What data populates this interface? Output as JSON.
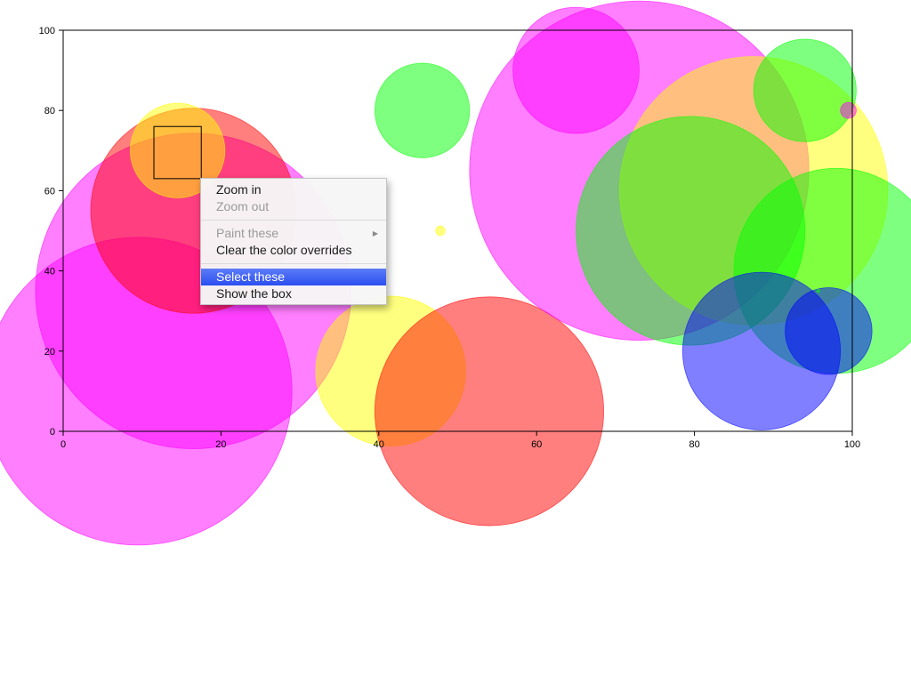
{
  "chart_data": {
    "type": "scatter",
    "variant": "bubble",
    "title": "",
    "xlabel": "",
    "ylabel": "",
    "xlim": [
      0,
      100
    ],
    "ylim": [
      0,
      100
    ],
    "x_ticks": [
      0,
      20,
      40,
      60,
      80,
      100
    ],
    "y_ticks": [
      0,
      20,
      40,
      60,
      80,
      100
    ],
    "grid": false,
    "legend": "none",
    "colors": {
      "magenta": "#ff00ff",
      "red": "#ff0000",
      "yellow": "#ffff00",
      "green": "#00ff00",
      "blue": "#0000ff"
    },
    "bubbles": [
      {
        "x": 9.5,
        "y": 10,
        "r": 19.5,
        "color": "magenta"
      },
      {
        "x": 16.5,
        "y": 35,
        "r": 20,
        "color": "magenta"
      },
      {
        "x": 16.5,
        "y": 55,
        "r": 13,
        "color": "red"
      },
      {
        "x": 14.5,
        "y": 70,
        "r": 6,
        "color": "yellow"
      },
      {
        "x": 41.5,
        "y": 15,
        "r": 9.5,
        "color": "yellow"
      },
      {
        "x": 54,
        "y": 5,
        "r": 14.5,
        "color": "red"
      },
      {
        "x": 45.5,
        "y": 80,
        "r": 6,
        "color": "green"
      },
      {
        "x": 47.8,
        "y": 50,
        "r": 0.6,
        "color": "yellow"
      },
      {
        "x": 65,
        "y": 90,
        "r": 8,
        "color": "magenta"
      },
      {
        "x": 73,
        "y": 65,
        "r": 21.5,
        "color": "magenta"
      },
      {
        "x": 87.5,
        "y": 60,
        "r": 17,
        "color": "yellow"
      },
      {
        "x": 79.5,
        "y": 50,
        "r": 14.5,
        "color": "green"
      },
      {
        "x": 94,
        "y": 85,
        "r": 6.5,
        "color": "green"
      },
      {
        "x": 99.5,
        "y": 80,
        "r": 1,
        "color": "magenta"
      },
      {
        "x": 98,
        "y": 40,
        "r": 13,
        "color": "green"
      },
      {
        "x": 88.5,
        "y": 20,
        "r": 10,
        "color": "blue"
      },
      {
        "x": 97,
        "y": 25,
        "r": 5.5,
        "color": "blue"
      },
      {
        "x": 95.7,
        "y": 35,
        "r": 0.2,
        "color": "green"
      }
    ],
    "selection_box": {
      "x0": 11.5,
      "x1": 17.5,
      "y0": 63,
      "y1": 76
    }
  },
  "context_menu": {
    "items": [
      {
        "label": "Zoom in",
        "state": "enabled",
        "submenu": false,
        "name": "menu-item-zoom-in"
      },
      {
        "label": "Zoom out",
        "state": "disabled",
        "submenu": false,
        "name": "menu-item-zoom-out"
      },
      {
        "separator": true
      },
      {
        "label": "Paint these",
        "state": "disabled",
        "submenu": true,
        "name": "menu-item-paint-these"
      },
      {
        "label": "Clear the color overrides",
        "state": "enabled",
        "submenu": false,
        "name": "menu-item-clear-color-overrides"
      },
      {
        "separator": true
      },
      {
        "label": "Select these",
        "state": "highlighted",
        "submenu": false,
        "name": "menu-item-select-these"
      },
      {
        "label": "Show the box",
        "state": "enabled",
        "submenu": false,
        "name": "menu-item-show-the-box"
      }
    ]
  }
}
